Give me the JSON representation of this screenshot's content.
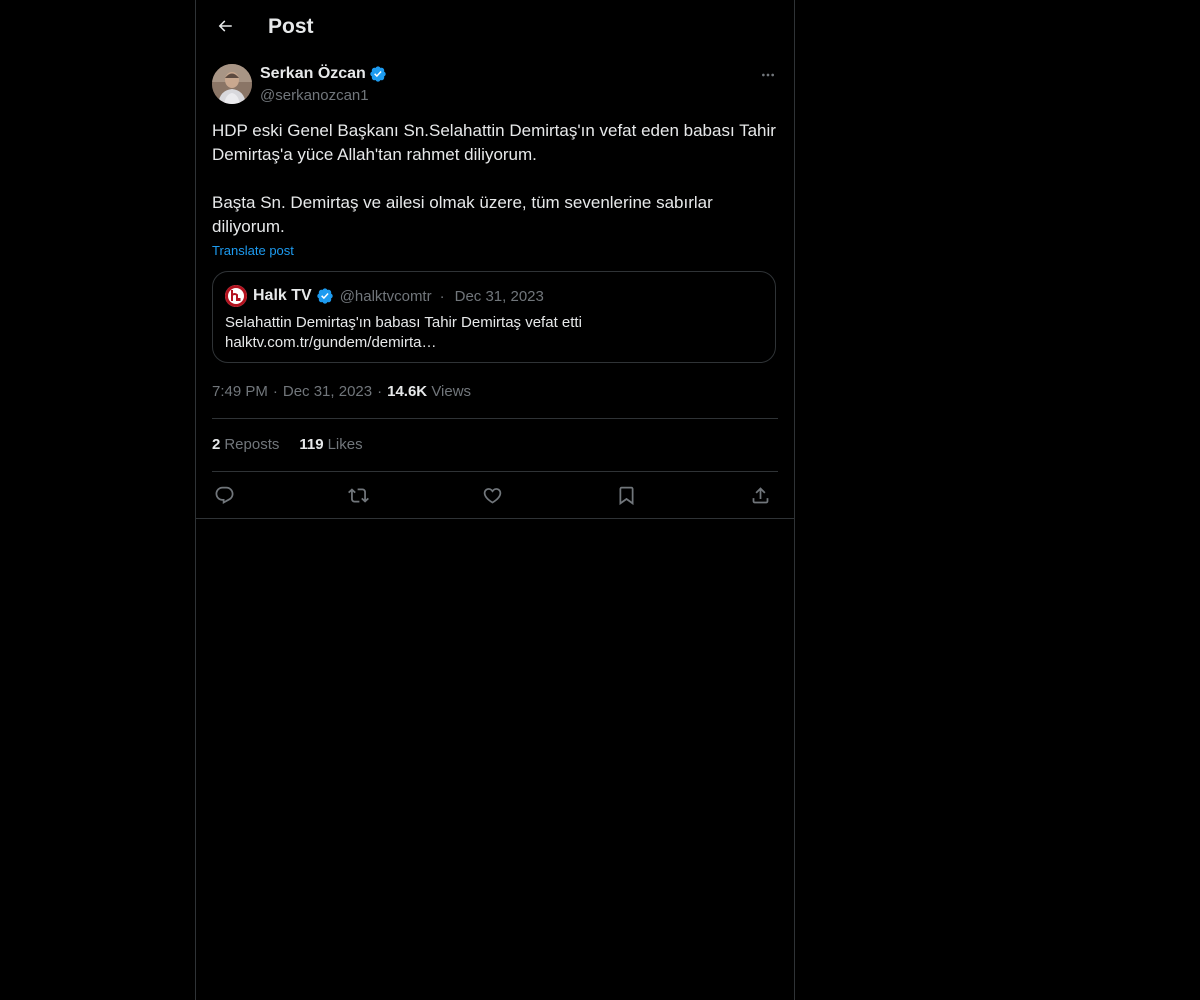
{
  "header": {
    "title": "Post",
    "back_icon": "arrow-left-icon"
  },
  "post": {
    "author": {
      "name": "Serkan Özcan",
      "handle": "@serkanozcan1",
      "verified": true
    },
    "text": [
      "HDP eski Genel Başkanı Sn.Selahattin Demirtaş'ın vefat eden babası Tahir Demirtaş'a yüce Allah'tan rahmet diliyorum.",
      "Başta Sn. Demirtaş ve ailesi olmak üzere, tüm sevenlerine sabırlar diliyorum."
    ],
    "translate_label": "Translate post",
    "quote": {
      "name": "Halk TV",
      "handle": "@halktvcomtr",
      "date": "Dec 31, 2023",
      "text_line1": "Selahattin Demirtaş'ın babası Tahir Demirtaş vefat etti",
      "text_line2": "halktv.com.tr/gundem/demirta…"
    },
    "time": "7:49 PM",
    "date": "Dec 31, 2023",
    "views_count": "14.6K",
    "views_label": "Views",
    "reposts_count": "2",
    "reposts_label": "Reposts",
    "likes_count": "119",
    "likes_label": "Likes"
  },
  "colors": {
    "background": "#000000",
    "text": "#e7e9ea",
    "muted": "#71767b",
    "border": "#2f3336",
    "accent": "#1d9bf0"
  },
  "actions": [
    "reply-icon",
    "repost-icon",
    "like-icon",
    "bookmark-icon",
    "share-icon"
  ]
}
